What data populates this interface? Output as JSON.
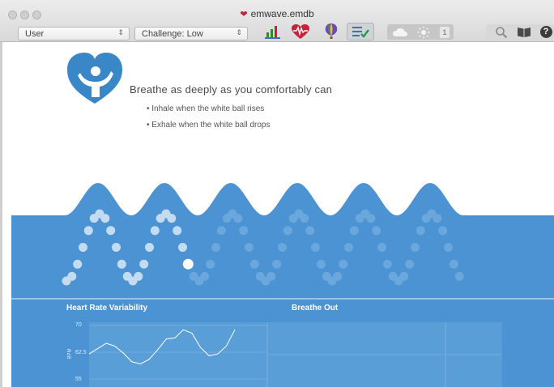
{
  "window": {
    "title": "emwave.emdb"
  },
  "toolbar": {
    "user_select": "User",
    "challenge_select": "Challenge: Low",
    "icons": [
      "bar-chart-icon",
      "heart-wave-icon",
      "balloon-icon",
      "checklist-icon",
      "cloud-icon",
      "sun-icon",
      "number-badge-icon",
      "search-icon",
      "book-icon",
      "help-icon"
    ],
    "badge_number": "1",
    "help_glyph": "?"
  },
  "instructions": {
    "headline": "Breathe as deeply as you comfortably can",
    "bullets": [
      "• Inhale when the white ball rises",
      "• Exhale when the white ball drops"
    ]
  },
  "panels": {
    "hrv_label": "Heart Rate Variability",
    "breathe_label": "Breathe Out",
    "y_axis_unit": "BPM",
    "y_ticks": [
      "70",
      "62.5",
      "55"
    ]
  },
  "breath_pacer": {
    "ball_progress": 0.31,
    "cycles": 6
  },
  "colors": {
    "brand_blue": "#4a90d0",
    "wave_blue": "#4b93d2",
    "heart_red": "#c8213a"
  },
  "chart_data": {
    "type": "line",
    "title": "Heart Rate Variability",
    "ylabel": "BPM",
    "ylim": [
      55,
      70
    ],
    "y_ticks": [
      70,
      62.5,
      55
    ],
    "series": [
      {
        "values": [
          62,
          63.5,
          65,
          64.2,
          62.2,
          59.8,
          59.2,
          60.5,
          63.2,
          66.2,
          66.5,
          68.8,
          67.8,
          63.8,
          61.5,
          62,
          64.2,
          68.8
        ]
      }
    ],
    "grid": true
  }
}
